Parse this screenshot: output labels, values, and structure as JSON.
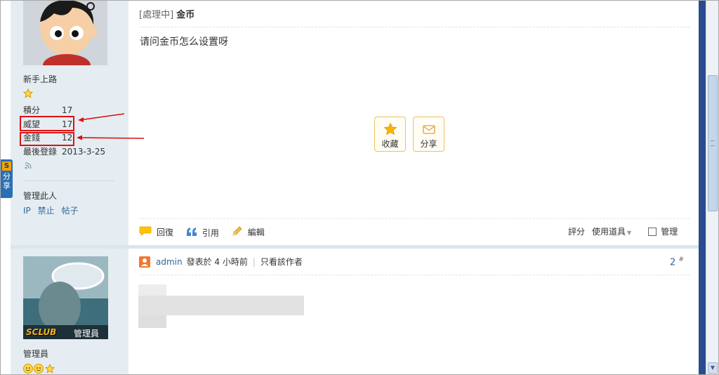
{
  "post1": {
    "status_tag": "[處理中]",
    "title": "金币",
    "body": "请问金币怎么设置呀",
    "buttons": {
      "favorite": "收藏",
      "share": "分享"
    },
    "actions": {
      "reply": "回復",
      "quote": "引用",
      "edit": "編輯"
    },
    "right_actions": {
      "rate": "評分",
      "tools": "使用道具",
      "manage": "管理"
    }
  },
  "author1": {
    "usergroup": "新手上路",
    "stats": [
      {
        "label": "積分",
        "value": "17"
      },
      {
        "label": "威望",
        "value": "17"
      },
      {
        "label": "金錢",
        "value": "12"
      },
      {
        "label": "最後登錄",
        "value": "2013-3-25"
      }
    ],
    "manage_label": "管理此人",
    "manage_links": [
      "IP",
      "禁止",
      "帖子"
    ]
  },
  "share_tab": {
    "badge": "S",
    "text": "分享"
  },
  "post2": {
    "author": "admin",
    "posted": "發表於 4 小時前",
    "only_author": "只看該作者",
    "floor": "2",
    "floor_mark": "#"
  },
  "author2": {
    "avatar_text": "SCLUB",
    "avatar_caption": "管理員",
    "usergroup": "管理員"
  },
  "colors": {
    "accent": "#336699",
    "annotation": "#dd1111",
    "side_bg": "#e5edf2"
  }
}
